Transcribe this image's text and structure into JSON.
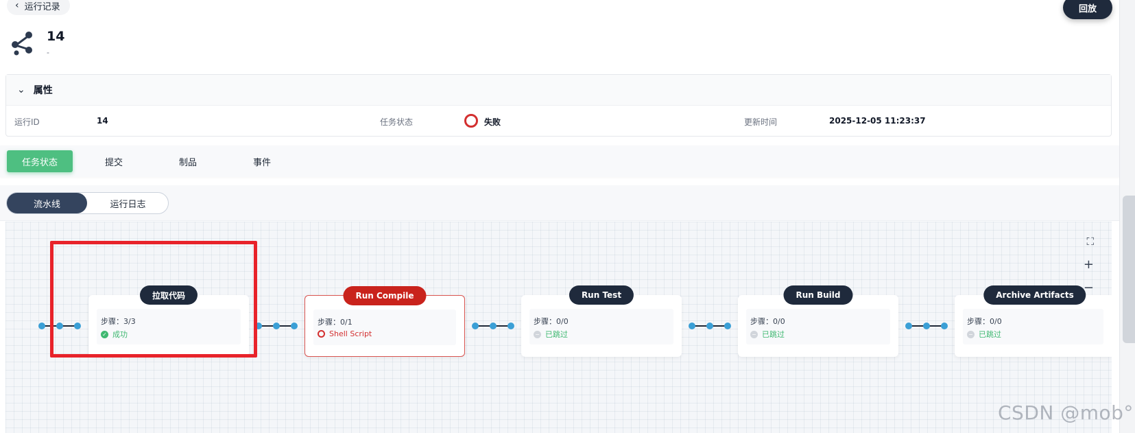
{
  "header": {
    "back_label": "运行记录",
    "run_number": "14",
    "run_sub": "-",
    "replay_label": "回放"
  },
  "properties": {
    "title": "属性",
    "run_id_label": "运行ID",
    "run_id_value": "14",
    "status_label": "任务状态",
    "status_value": "失败",
    "updated_label": "更新时间",
    "updated_value": "2025-12-05 11:23:37",
    "status_color": "#d32f2f"
  },
  "tabs": [
    "任务状态",
    "提交",
    "制品",
    "事件"
  ],
  "view_toggle": {
    "pipeline": "流水线",
    "logs": "运行日志"
  },
  "stages": [
    {
      "name": "拉取代码",
      "steps": "步骤：3/3",
      "status": "成功",
      "state": "success"
    },
    {
      "name": "Run Compile",
      "steps": "步骤：0/1",
      "status": "Shell Script",
      "state": "failed"
    },
    {
      "name": "Run Test",
      "steps": "步骤：0/0",
      "status": "已跳过",
      "state": "skipped"
    },
    {
      "name": "Run Build",
      "steps": "步骤：0/0",
      "status": "已跳过",
      "state": "skipped"
    },
    {
      "name": "Archive Artifacts",
      "steps": "步骤：0/0",
      "status": "已跳过",
      "state": "skipped"
    }
  ],
  "controls": {
    "fit": "⛶",
    "zoom_in": "+",
    "zoom_out": "−"
  },
  "watermark": "CSDN @mob°",
  "colors": {
    "primary_tab": "#4ebf81",
    "dark": "#1f2a3c",
    "fail": "#c9231c",
    "connector_dot": "#3a9fd6"
  }
}
